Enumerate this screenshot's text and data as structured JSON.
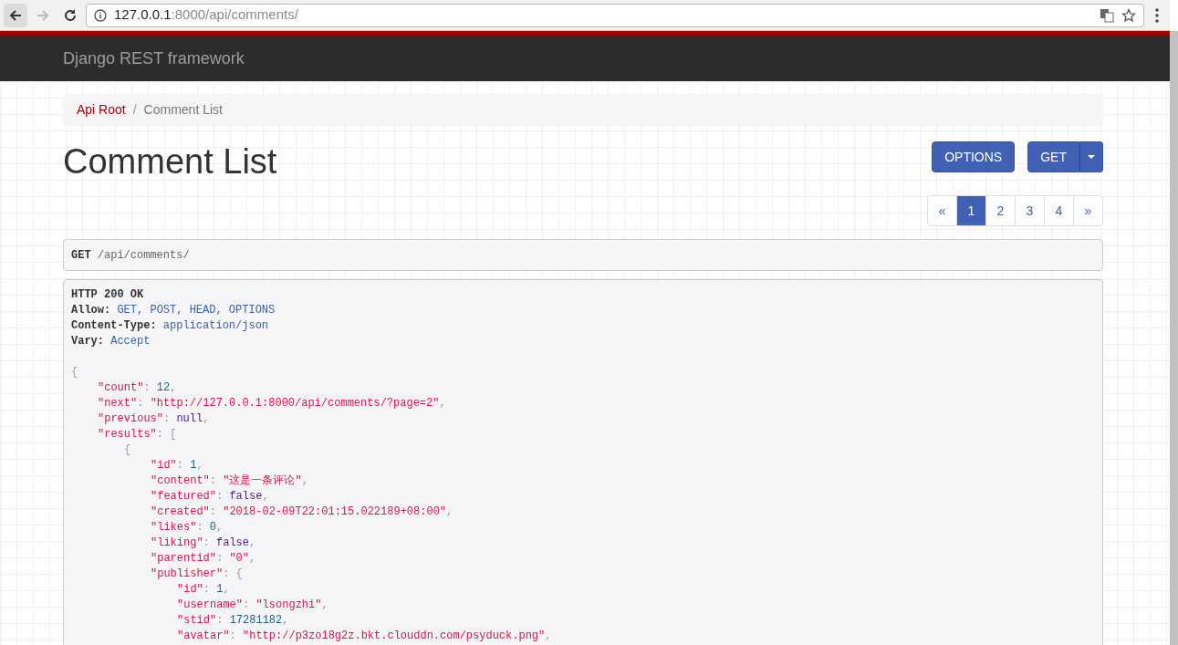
{
  "browser": {
    "url_host": "127.0.0.1",
    "url_rest": ":8000/api/comments/"
  },
  "navbar": {
    "brand": "Django REST framework"
  },
  "breadcrumb_separator": "/",
  "breadcrumb": [
    {
      "label": "Api Root",
      "selected": false
    },
    {
      "label": "Comment List",
      "selected": true
    }
  ],
  "title": "Comment List",
  "buttons": {
    "options": "OPTIONS",
    "get": "GET"
  },
  "pagination": [
    {
      "label": "«",
      "selected": false
    },
    {
      "label": "1",
      "selected": true
    },
    {
      "label": "2",
      "selected": false
    },
    {
      "label": "3",
      "selected": false
    },
    {
      "label": "4",
      "selected": false
    },
    {
      "label": "»",
      "selected": false
    }
  ],
  "request": {
    "method": "GET",
    "path": "/api/comments/"
  },
  "response": {
    "status": "HTTP 200 OK",
    "headers": [
      {
        "label": "Allow:",
        "value": "GET, POST, HEAD, OPTIONS"
      },
      {
        "label": "Content-Type:",
        "value": "application/json"
      },
      {
        "label": "Vary:",
        "value": "Accept"
      }
    ],
    "body": [
      {
        "tokens": [
          {
            "kind": "punct",
            "text": "{"
          }
        ],
        "children": [
          {
            "tokens": [
              {
                "kind": "key",
                "text": "\"count\""
              },
              {
                "kind": "punct",
                "text": ": "
              },
              {
                "kind": "number",
                "text": "12"
              },
              {
                "kind": "punct",
                "text": ","
              }
            ]
          },
          {
            "tokens": [
              {
                "kind": "key",
                "text": "\"next\""
              },
              {
                "kind": "punct",
                "text": ": "
              },
              {
                "kind": "string",
                "text": "\"http://127.0.0.1:8000/api/comments/?page=2\""
              },
              {
                "kind": "punct",
                "text": ","
              }
            ]
          },
          {
            "tokens": [
              {
                "kind": "key",
                "text": "\"previous\""
              },
              {
                "kind": "punct",
                "text": ": "
              },
              {
                "kind": "literal",
                "text": "null"
              },
              {
                "kind": "punct",
                "text": ","
              }
            ]
          },
          {
            "tokens": [
              {
                "kind": "key",
                "text": "\"results\""
              },
              {
                "kind": "punct",
                "text": ": ["
              }
            ],
            "children": [
              {
                "tokens": [
                  {
                    "kind": "punct",
                    "text": "{"
                  }
                ],
                "children": [
                  {
                    "tokens": [
                      {
                        "kind": "key",
                        "text": "\"id\""
                      },
                      {
                        "kind": "punct",
                        "text": ": "
                      },
                      {
                        "kind": "number",
                        "text": "1"
                      },
                      {
                        "kind": "punct",
                        "text": ","
                      }
                    ]
                  },
                  {
                    "tokens": [
                      {
                        "kind": "key",
                        "text": "\"content\""
                      },
                      {
                        "kind": "punct",
                        "text": ": "
                      },
                      {
                        "kind": "string",
                        "text": "\"这是一条评论\""
                      },
                      {
                        "kind": "punct",
                        "text": ","
                      }
                    ]
                  },
                  {
                    "tokens": [
                      {
                        "kind": "key",
                        "text": "\"featured\""
                      },
                      {
                        "kind": "punct",
                        "text": ": "
                      },
                      {
                        "kind": "literal",
                        "text": "false"
                      },
                      {
                        "kind": "punct",
                        "text": ","
                      }
                    ]
                  },
                  {
                    "tokens": [
                      {
                        "kind": "key",
                        "text": "\"created\""
                      },
                      {
                        "kind": "punct",
                        "text": ": "
                      },
                      {
                        "kind": "string",
                        "text": "\"2018-02-09T22:01:15.022189+08:00\""
                      },
                      {
                        "kind": "punct",
                        "text": ","
                      }
                    ]
                  },
                  {
                    "tokens": [
                      {
                        "kind": "key",
                        "text": "\"likes\""
                      },
                      {
                        "kind": "punct",
                        "text": ": "
                      },
                      {
                        "kind": "number",
                        "text": "0"
                      },
                      {
                        "kind": "punct",
                        "text": ","
                      }
                    ]
                  },
                  {
                    "tokens": [
                      {
                        "kind": "key",
                        "text": "\"liking\""
                      },
                      {
                        "kind": "punct",
                        "text": ": "
                      },
                      {
                        "kind": "literal",
                        "text": "false"
                      },
                      {
                        "kind": "punct",
                        "text": ","
                      }
                    ]
                  },
                  {
                    "tokens": [
                      {
                        "kind": "key",
                        "text": "\"parentid\""
                      },
                      {
                        "kind": "punct",
                        "text": ": "
                      },
                      {
                        "kind": "string",
                        "text": "\"0\""
                      },
                      {
                        "kind": "punct",
                        "text": ","
                      }
                    ]
                  },
                  {
                    "tokens": [
                      {
                        "kind": "key",
                        "text": "\"publisher\""
                      },
                      {
                        "kind": "punct",
                        "text": ": {"
                      }
                    ],
                    "children": [
                      {
                        "tokens": [
                          {
                            "kind": "key",
                            "text": "\"id\""
                          },
                          {
                            "kind": "punct",
                            "text": ": "
                          },
                          {
                            "kind": "number",
                            "text": "1"
                          },
                          {
                            "kind": "punct",
                            "text": ","
                          }
                        ]
                      },
                      {
                        "tokens": [
                          {
                            "kind": "key",
                            "text": "\"username\""
                          },
                          {
                            "kind": "punct",
                            "text": ": "
                          },
                          {
                            "kind": "string",
                            "text": "\"lsongzhi\""
                          },
                          {
                            "kind": "punct",
                            "text": ","
                          }
                        ]
                      },
                      {
                        "tokens": [
                          {
                            "kind": "key",
                            "text": "\"stid\""
                          },
                          {
                            "kind": "punct",
                            "text": ": "
                          },
                          {
                            "kind": "number",
                            "text": "17281182"
                          },
                          {
                            "kind": "punct",
                            "text": ","
                          }
                        ]
                      },
                      {
                        "tokens": [
                          {
                            "kind": "key",
                            "text": "\"avatar\""
                          },
                          {
                            "kind": "punct",
                            "text": ": "
                          },
                          {
                            "kind": "string",
                            "text": "\"http://p3zo18g2z.bkt.clouddn.com/psyduck.png\""
                          },
                          {
                            "kind": "punct",
                            "text": ","
                          }
                        ]
                      }
                    ]
                  }
                ]
              }
            ]
          }
        ]
      }
    ]
  }
}
